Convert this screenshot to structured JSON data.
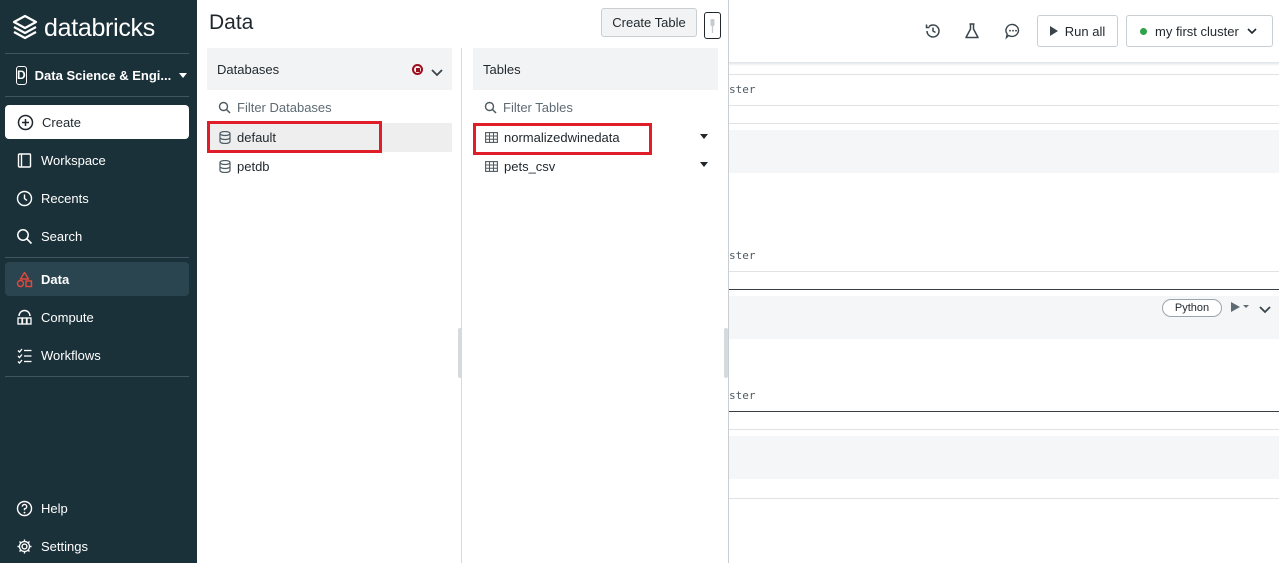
{
  "sidebar": {
    "brand": "databricks",
    "workspace": {
      "badge": "D",
      "label": "Data Science & Engi..."
    },
    "create_label": "Create",
    "items": [
      {
        "label": "Workspace",
        "icon": "workspace-icon"
      },
      {
        "label": "Recents",
        "icon": "clock-icon"
      },
      {
        "label": "Search",
        "icon": "search-icon"
      },
      {
        "label": "Data",
        "icon": "data-icon",
        "active": true
      },
      {
        "label": "Compute",
        "icon": "compute-icon"
      },
      {
        "label": "Workflows",
        "icon": "workflows-icon"
      }
    ],
    "help_label": "Help",
    "settings_label": "Settings"
  },
  "data_panel": {
    "title": "Data",
    "create_table_label": "Create Table",
    "databases": {
      "header": "Databases",
      "filter_placeholder": "Filter Databases",
      "items": [
        "default",
        "petdb"
      ],
      "selected": "default"
    },
    "tables": {
      "header": "Tables",
      "filter_placeholder": "Filter Tables",
      "items": [
        "normalizedwinedata",
        "pets_csv"
      ]
    }
  },
  "notebook": {
    "run_all_label": "Run all",
    "cluster_name": "my first cluster",
    "cluster_status_color": "#2fa24a",
    "cell_text_fragments": [
      "ster",
      "ster",
      "ster"
    ],
    "language_badge": "Python"
  },
  "colors": {
    "sidebar_bg": "#1b3139",
    "highlight": "#e01e2a",
    "data_icon": "#e8473a"
  }
}
